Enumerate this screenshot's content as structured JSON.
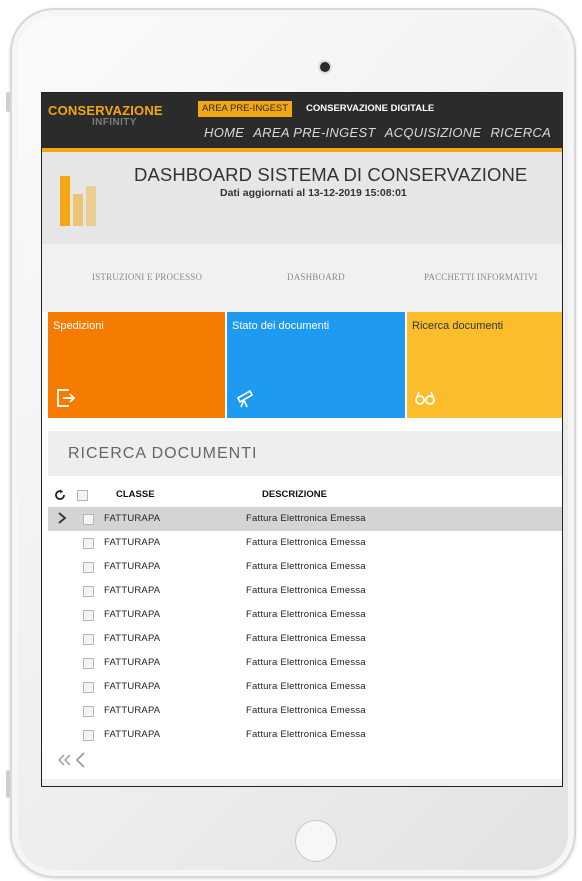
{
  "app": {
    "logo_main": "CONSERVAZIONE",
    "logo_sub": "INFINITY",
    "tabs": [
      "AREA PRE-INGEST",
      "CONSERVAZIONE DIGITALE"
    ],
    "nav_links": [
      "HOME",
      "AREA PRE-INGEST",
      "ACQUISIZIONE",
      "RICERCA"
    ],
    "accent_color": "#f3a712"
  },
  "dashboard": {
    "title": "DASHBOARD SISTEMA DI CONSERVAZIONE",
    "subtitle": "Dati aggiornati al 13-12-2019 15:08:01"
  },
  "subnav": [
    "ISTRUZIONI E PROCESSO",
    "DASHBOARD",
    "PACCHETTI INFORMATIVI"
  ],
  "tiles": [
    {
      "label": "Spedizioni",
      "icon": "exit-arrow-icon",
      "color": "#f57c00"
    },
    {
      "label": "Stato dei documenti",
      "icon": "telescope-icon",
      "color": "#1e9bf0"
    },
    {
      "label": "Ricerca documenti",
      "icon": "glasses-icon",
      "color": "#fbbd2c"
    }
  ],
  "search": {
    "title": "RICERCA DOCUMENTI",
    "columns": [
      "CLASSE",
      "DESCRIZIONE"
    ],
    "rows": [
      {
        "classe": "FATTURAPA",
        "descrizione": "Fattura Elettronica Emessa",
        "selected": true
      },
      {
        "classe": "FATTURAPA",
        "descrizione": "Fattura Elettronica Emessa"
      },
      {
        "classe": "FATTURAPA",
        "descrizione": "Fattura Elettronica Emessa"
      },
      {
        "classe": "FATTURAPA",
        "descrizione": "Fattura Elettronica Emessa"
      },
      {
        "classe": "FATTURAPA",
        "descrizione": "Fattura Elettronica Emessa"
      },
      {
        "classe": "FATTURAPA",
        "descrizione": "Fattura Elettronica Emessa"
      },
      {
        "classe": "FATTURAPA",
        "descrizione": "Fattura Elettronica Emessa"
      },
      {
        "classe": "FATTURAPA",
        "descrizione": "Fattura Elettronica Emessa"
      },
      {
        "classe": "FATTURAPA",
        "descrizione": "Fattura Elettronica Emessa"
      },
      {
        "classe": "FATTURAPA",
        "descrizione": "Fattura Elettronica Emessa"
      }
    ]
  }
}
